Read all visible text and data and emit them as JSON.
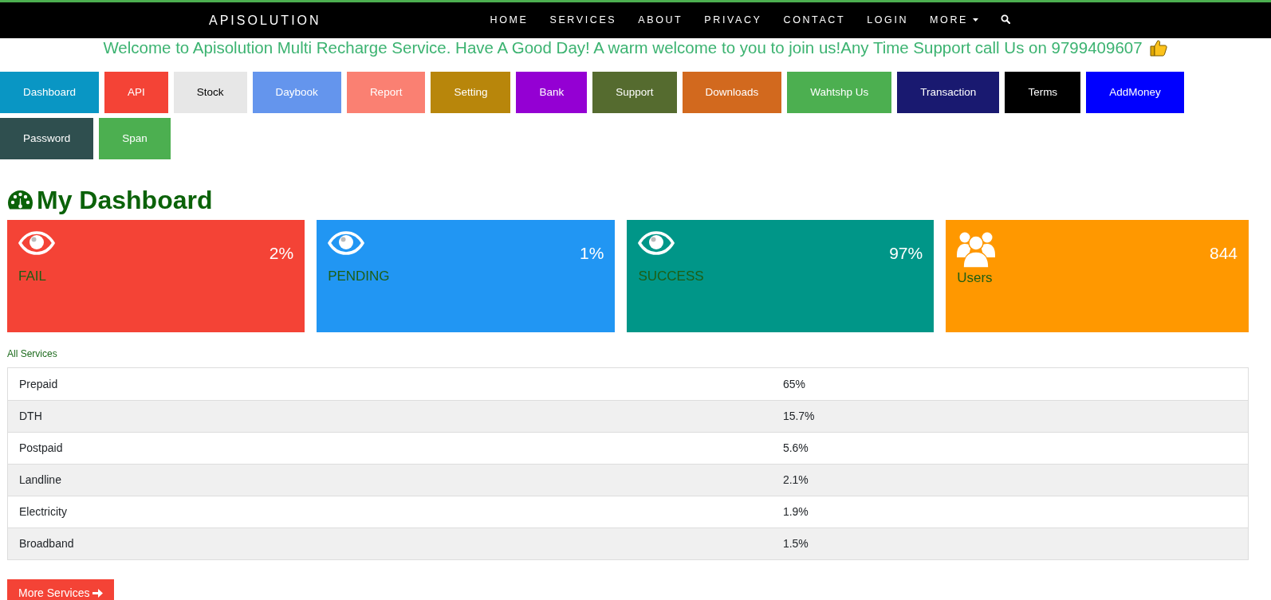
{
  "navbar": {
    "brand": "APISOLUTION",
    "links": [
      {
        "label": "HOME"
      },
      {
        "label": "SERVICES"
      },
      {
        "label": "ABOUT"
      },
      {
        "label": "PRIVACY"
      },
      {
        "label": "CONTACT"
      },
      {
        "label": "LOGIN"
      },
      {
        "label": "MORE",
        "dropdown": true
      }
    ]
  },
  "welcome": "Welcome to Apisolution Multi Recharge Service. Have A Good Day! A warm welcome to you to join us!Any Time Support call Us on 9799409607",
  "menu_buttons": [
    {
      "label": "Dashboard",
      "color": "#0996c4"
    },
    {
      "label": "API",
      "color": "#f44336"
    },
    {
      "label": "Stock",
      "color": "#e7e7e7"
    },
    {
      "label": "Daybook",
      "color": "#6495ed"
    },
    {
      "label": "Report",
      "color": "#fa8072"
    },
    {
      "label": "Setting",
      "color": "#b8860b"
    },
    {
      "label": "Bank",
      "color": "#9400d3"
    },
    {
      "label": "Support",
      "color": "#556b2f"
    },
    {
      "label": "Downloads",
      "color": "#d2691e"
    },
    {
      "label": "Wahtshp Us",
      "color": "#4caf50"
    },
    {
      "label": "Transaction",
      "color": "#191970"
    },
    {
      "label": "Terms",
      "color": "#000000"
    },
    {
      "label": "AddMoney",
      "color": "#0000ff"
    },
    {
      "label": "Password",
      "color": "#2f4f4f"
    },
    {
      "label": "Span",
      "color": "#4caf50"
    }
  ],
  "heading": "My Dashboard",
  "stat_cards": [
    {
      "label": "FAIL",
      "value": "2%",
      "kind": "eye",
      "color": "#f44336"
    },
    {
      "label": "PENDING",
      "value": "1%",
      "kind": "eye",
      "color": "#2196f3"
    },
    {
      "label": "SUCCESS",
      "value": "97%",
      "kind": "eye",
      "color": "#009688"
    },
    {
      "label": "Users",
      "value": "844",
      "kind": "users",
      "color": "#ff9800"
    }
  ],
  "services": {
    "title": "All Services",
    "rows": [
      {
        "name": "Prepaid",
        "share": "65%"
      },
      {
        "name": "DTH",
        "share": "15.7%"
      },
      {
        "name": "Postpaid",
        "share": "5.6%"
      },
      {
        "name": "Landline",
        "share": "2.1%"
      },
      {
        "name": "Electricity",
        "share": "1.9%"
      },
      {
        "name": "Broadband",
        "share": "1.5%"
      }
    ]
  },
  "more_button": "More Services"
}
